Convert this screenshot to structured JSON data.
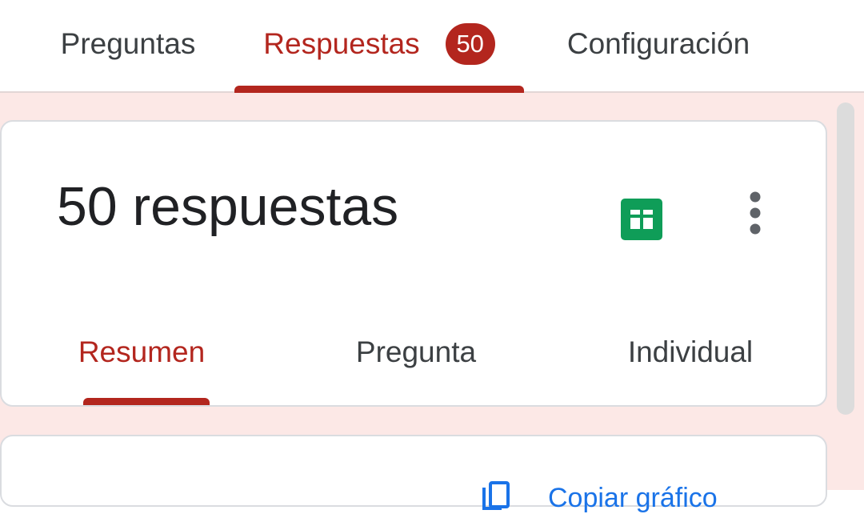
{
  "top_tabs": [
    {
      "label": "Preguntas"
    },
    {
      "label": "Respuestas",
      "badge": "50"
    },
    {
      "label": "Configuración"
    }
  ],
  "summary": {
    "title": "50 respuestas",
    "icons": {
      "sheets": "sheets-icon",
      "more": "more-vert-icon"
    },
    "sub_tabs": [
      {
        "label": "Resumen"
      },
      {
        "label": "Pregunta"
      },
      {
        "label": "Individual"
      }
    ]
  },
  "next_card": {
    "action_label": "Copiar gráfico",
    "icon": "copy-icon"
  },
  "colors": {
    "accent": "#b3261e",
    "background": "#fce8e6",
    "sheets_green": "#0f9d58",
    "link_blue": "#1a73e8"
  }
}
